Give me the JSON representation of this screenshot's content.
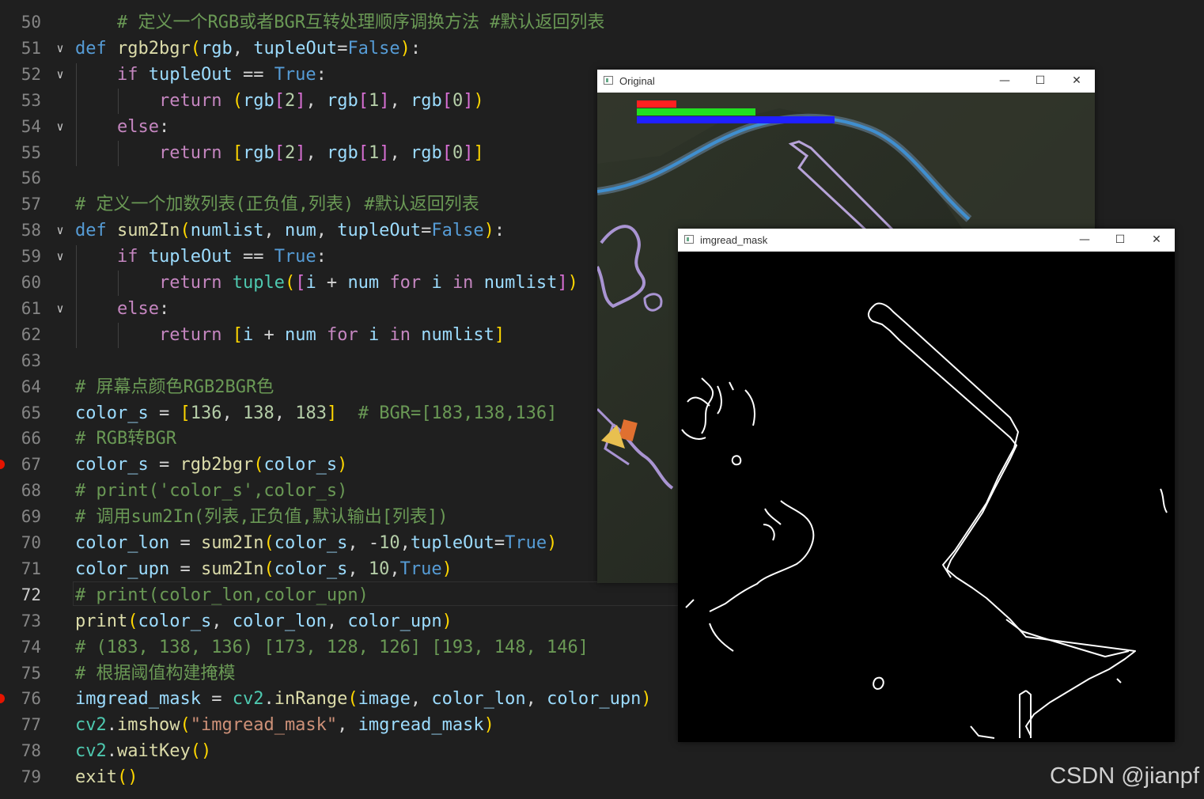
{
  "editor": {
    "active_line": "72",
    "lines": [
      {
        "n": "50",
        "fold": "",
        "bp": false,
        "tokens": [
          {
            "t": "    # 定义一个RGB或者BGR互转处理顺序调换方法 #默认返回列表",
            "c": "c-comment"
          }
        ]
      },
      {
        "n": "51",
        "fold": "∨",
        "bp": false,
        "tokens": [
          {
            "t": "def",
            "c": "c-kw"
          },
          {
            "t": " "
          },
          {
            "t": "rgb2bgr",
            "c": "c-fn"
          },
          {
            "t": "(",
            "c": "b1"
          },
          {
            "t": "rgb",
            "c": "c-var"
          },
          {
            "t": ", "
          },
          {
            "t": "tupleOut",
            "c": "c-var"
          },
          {
            "t": "="
          },
          {
            "t": "False",
            "c": "c-kw"
          },
          {
            "t": ")",
            "c": "b1"
          },
          {
            "t": ":"
          }
        ]
      },
      {
        "n": "52",
        "fold": "∨",
        "bp": false,
        "tokens": [
          {
            "t": "    "
          },
          {
            "t": "if",
            "c": "c-ctrl"
          },
          {
            "t": " "
          },
          {
            "t": "tupleOut",
            "c": "c-var"
          },
          {
            "t": " == "
          },
          {
            "t": "True",
            "c": "c-kw"
          },
          {
            "t": ":"
          }
        ]
      },
      {
        "n": "53",
        "fold": "",
        "bp": false,
        "tokens": [
          {
            "t": "        "
          },
          {
            "t": "return",
            "c": "c-ctrl"
          },
          {
            "t": " "
          },
          {
            "t": "(",
            "c": "b1"
          },
          {
            "t": "rgb",
            "c": "c-var"
          },
          {
            "t": "[",
            "c": "b2"
          },
          {
            "t": "2",
            "c": "c-num"
          },
          {
            "t": "]",
            "c": "b2"
          },
          {
            "t": ", "
          },
          {
            "t": "rgb",
            "c": "c-var"
          },
          {
            "t": "[",
            "c": "b2"
          },
          {
            "t": "1",
            "c": "c-num"
          },
          {
            "t": "]",
            "c": "b2"
          },
          {
            "t": ", "
          },
          {
            "t": "rgb",
            "c": "c-var"
          },
          {
            "t": "[",
            "c": "b2"
          },
          {
            "t": "0",
            "c": "c-num"
          },
          {
            "t": "]",
            "c": "b2"
          },
          {
            "t": ")",
            "c": "b1"
          }
        ]
      },
      {
        "n": "54",
        "fold": "∨",
        "bp": false,
        "tokens": [
          {
            "t": "    "
          },
          {
            "t": "else",
            "c": "c-ctrl"
          },
          {
            "t": ":"
          }
        ]
      },
      {
        "n": "55",
        "fold": "",
        "bp": false,
        "tokens": [
          {
            "t": "        "
          },
          {
            "t": "return",
            "c": "c-ctrl"
          },
          {
            "t": " "
          },
          {
            "t": "[",
            "c": "b1"
          },
          {
            "t": "rgb",
            "c": "c-var"
          },
          {
            "t": "[",
            "c": "b2"
          },
          {
            "t": "2",
            "c": "c-num"
          },
          {
            "t": "]",
            "c": "b2"
          },
          {
            "t": ", "
          },
          {
            "t": "rgb",
            "c": "c-var"
          },
          {
            "t": "[",
            "c": "b2"
          },
          {
            "t": "1",
            "c": "c-num"
          },
          {
            "t": "]",
            "c": "b2"
          },
          {
            "t": ", "
          },
          {
            "t": "rgb",
            "c": "c-var"
          },
          {
            "t": "[",
            "c": "b2"
          },
          {
            "t": "0",
            "c": "c-num"
          },
          {
            "t": "]",
            "c": "b2"
          },
          {
            "t": "]",
            "c": "b1"
          }
        ]
      },
      {
        "n": "56",
        "fold": "",
        "bp": false,
        "tokens": []
      },
      {
        "n": "57",
        "fold": "",
        "bp": false,
        "tokens": [
          {
            "t": "# 定义一个加数列表(正负值,列表) #默认返回列表",
            "c": "c-comment"
          }
        ]
      },
      {
        "n": "58",
        "fold": "∨",
        "bp": false,
        "tokens": [
          {
            "t": "def",
            "c": "c-kw"
          },
          {
            "t": " "
          },
          {
            "t": "sum2In",
            "c": "c-fn"
          },
          {
            "t": "(",
            "c": "b1"
          },
          {
            "t": "numlist",
            "c": "c-var"
          },
          {
            "t": ", "
          },
          {
            "t": "num",
            "c": "c-var"
          },
          {
            "t": ", "
          },
          {
            "t": "tupleOut",
            "c": "c-var"
          },
          {
            "t": "="
          },
          {
            "t": "False",
            "c": "c-kw"
          },
          {
            "t": ")",
            "c": "b1"
          },
          {
            "t": ":"
          }
        ]
      },
      {
        "n": "59",
        "fold": "∨",
        "bp": false,
        "tokens": [
          {
            "t": "    "
          },
          {
            "t": "if",
            "c": "c-ctrl"
          },
          {
            "t": " "
          },
          {
            "t": "tupleOut",
            "c": "c-var"
          },
          {
            "t": " == "
          },
          {
            "t": "True",
            "c": "c-kw"
          },
          {
            "t": ":"
          }
        ]
      },
      {
        "n": "60",
        "fold": "",
        "bp": false,
        "tokens": [
          {
            "t": "        "
          },
          {
            "t": "return",
            "c": "c-ctrl"
          },
          {
            "t": " "
          },
          {
            "t": "tuple",
            "c": "c-cls"
          },
          {
            "t": "(",
            "c": "b1"
          },
          {
            "t": "[",
            "c": "b2"
          },
          {
            "t": "i",
            "c": "c-var"
          },
          {
            "t": " + "
          },
          {
            "t": "num",
            "c": "c-var"
          },
          {
            "t": " "
          },
          {
            "t": "for",
            "c": "c-ctrl"
          },
          {
            "t": " "
          },
          {
            "t": "i",
            "c": "c-var"
          },
          {
            "t": " "
          },
          {
            "t": "in",
            "c": "c-ctrl"
          },
          {
            "t": " "
          },
          {
            "t": "numlist",
            "c": "c-var"
          },
          {
            "t": "]",
            "c": "b2"
          },
          {
            "t": ")",
            "c": "b1"
          }
        ]
      },
      {
        "n": "61",
        "fold": "∨",
        "bp": false,
        "tokens": [
          {
            "t": "    "
          },
          {
            "t": "else",
            "c": "c-ctrl"
          },
          {
            "t": ":"
          }
        ]
      },
      {
        "n": "62",
        "fold": "",
        "bp": false,
        "tokens": [
          {
            "t": "        "
          },
          {
            "t": "return",
            "c": "c-ctrl"
          },
          {
            "t": " "
          },
          {
            "t": "[",
            "c": "b1"
          },
          {
            "t": "i",
            "c": "c-var"
          },
          {
            "t": " + "
          },
          {
            "t": "num",
            "c": "c-var"
          },
          {
            "t": " "
          },
          {
            "t": "for",
            "c": "c-ctrl"
          },
          {
            "t": " "
          },
          {
            "t": "i",
            "c": "c-var"
          },
          {
            "t": " "
          },
          {
            "t": "in",
            "c": "c-ctrl"
          },
          {
            "t": " "
          },
          {
            "t": "numlist",
            "c": "c-var"
          },
          {
            "t": "]",
            "c": "b1"
          }
        ]
      },
      {
        "n": "63",
        "fold": "",
        "bp": false,
        "tokens": []
      },
      {
        "n": "64",
        "fold": "",
        "bp": false,
        "tokens": [
          {
            "t": "# 屏幕点颜色RGB2BGR色",
            "c": "c-comment"
          }
        ]
      },
      {
        "n": "65",
        "fold": "",
        "bp": false,
        "tokens": [
          {
            "t": "color_s",
            "c": "c-var"
          },
          {
            "t": " = "
          },
          {
            "t": "[",
            "c": "b1"
          },
          {
            "t": "136",
            "c": "c-num"
          },
          {
            "t": ", "
          },
          {
            "t": "138",
            "c": "c-num"
          },
          {
            "t": ", "
          },
          {
            "t": "183",
            "c": "c-num"
          },
          {
            "t": "]",
            "c": "b1"
          },
          {
            "t": "  "
          },
          {
            "t": "# BGR=[183,138,136]",
            "c": "c-comment"
          }
        ]
      },
      {
        "n": "66",
        "fold": "",
        "bp": false,
        "tokens": [
          {
            "t": "# RGB转BGR",
            "c": "c-comment"
          }
        ]
      },
      {
        "n": "67",
        "fold": "",
        "bp": true,
        "tokens": [
          {
            "t": "color_s",
            "c": "c-var"
          },
          {
            "t": " = "
          },
          {
            "t": "rgb2bgr",
            "c": "c-fn"
          },
          {
            "t": "(",
            "c": "b1"
          },
          {
            "t": "color_s",
            "c": "c-var"
          },
          {
            "t": ")",
            "c": "b1"
          }
        ]
      },
      {
        "n": "68",
        "fold": "",
        "bp": false,
        "tokens": [
          {
            "t": "# print('color_s',color_s)",
            "c": "c-comment"
          }
        ]
      },
      {
        "n": "69",
        "fold": "",
        "bp": false,
        "tokens": [
          {
            "t": "# 调用sum2In(列表,正负值,默认输出[列表])",
            "c": "c-comment"
          }
        ]
      },
      {
        "n": "70",
        "fold": "",
        "bp": false,
        "tokens": [
          {
            "t": "color_lon",
            "c": "c-var"
          },
          {
            "t": " = "
          },
          {
            "t": "sum2In",
            "c": "c-fn"
          },
          {
            "t": "(",
            "c": "b1"
          },
          {
            "t": "color_s",
            "c": "c-var"
          },
          {
            "t": ", -"
          },
          {
            "t": "10",
            "c": "c-num"
          },
          {
            "t": ","
          },
          {
            "t": "tupleOut",
            "c": "c-var"
          },
          {
            "t": "="
          },
          {
            "t": "True",
            "c": "c-kw"
          },
          {
            "t": ")",
            "c": "b1"
          }
        ]
      },
      {
        "n": "71",
        "fold": "",
        "bp": false,
        "tokens": [
          {
            "t": "color_upn",
            "c": "c-var"
          },
          {
            "t": " = "
          },
          {
            "t": "sum2In",
            "c": "c-fn"
          },
          {
            "t": "(",
            "c": "b1"
          },
          {
            "t": "color_s",
            "c": "c-var"
          },
          {
            "t": ", "
          },
          {
            "t": "10",
            "c": "c-num"
          },
          {
            "t": ","
          },
          {
            "t": "True",
            "c": "c-kw"
          },
          {
            "t": ")",
            "c": "b1"
          }
        ]
      },
      {
        "n": "72",
        "fold": "",
        "bp": false,
        "tokens": [
          {
            "t": "# print(color_lon,color_upn)",
            "c": "c-comment"
          }
        ]
      },
      {
        "n": "73",
        "fold": "",
        "bp": false,
        "tokens": [
          {
            "t": "print",
            "c": "c-fn"
          },
          {
            "t": "(",
            "c": "b1"
          },
          {
            "t": "color_s",
            "c": "c-var"
          },
          {
            "t": ", "
          },
          {
            "t": "color_lon",
            "c": "c-var"
          },
          {
            "t": ", "
          },
          {
            "t": "color_upn",
            "c": "c-var"
          },
          {
            "t": ")",
            "c": "b1"
          }
        ]
      },
      {
        "n": "74",
        "fold": "",
        "bp": false,
        "tokens": [
          {
            "t": "# (183, 138, 136) [173, 128, 126] [193, 148, 146]",
            "c": "c-comment"
          }
        ]
      },
      {
        "n": "75",
        "fold": "",
        "bp": false,
        "tokens": [
          {
            "t": "# 根据阈值构建掩模",
            "c": "c-comment"
          }
        ]
      },
      {
        "n": "76",
        "fold": "",
        "bp": true,
        "tokens": [
          {
            "t": "imgread_mask",
            "c": "c-var"
          },
          {
            "t": " = "
          },
          {
            "t": "cv2",
            "c": "c-cls"
          },
          {
            "t": "."
          },
          {
            "t": "inRange",
            "c": "c-fn"
          },
          {
            "t": "(",
            "c": "b1"
          },
          {
            "t": "image",
            "c": "c-var"
          },
          {
            "t": ", "
          },
          {
            "t": "color_lon",
            "c": "c-var"
          },
          {
            "t": ", "
          },
          {
            "t": "color_upn",
            "c": "c-var"
          },
          {
            "t": ")",
            "c": "b1"
          }
        ]
      },
      {
        "n": "77",
        "fold": "",
        "bp": false,
        "tokens": [
          {
            "t": "cv2",
            "c": "c-cls"
          },
          {
            "t": "."
          },
          {
            "t": "imshow",
            "c": "c-fn"
          },
          {
            "t": "(",
            "c": "b1"
          },
          {
            "t": "\"imgread_mask\"",
            "c": "c-str"
          },
          {
            "t": ", "
          },
          {
            "t": "imgread_mask",
            "c": "c-var"
          },
          {
            "t": ")",
            "c": "b1"
          }
        ]
      },
      {
        "n": "78",
        "fold": "",
        "bp": false,
        "tokens": [
          {
            "t": "cv2",
            "c": "c-cls"
          },
          {
            "t": "."
          },
          {
            "t": "waitKey",
            "c": "c-fn"
          },
          {
            "t": "(",
            "c": "b1"
          },
          {
            "t": ")",
            "c": "b1"
          }
        ]
      },
      {
        "n": "79",
        "fold": "",
        "bp": false,
        "tokens": [
          {
            "t": "exit",
            "c": "c-fn"
          },
          {
            "t": "(",
            "c": "b1"
          },
          {
            "t": ")",
            "c": "b1"
          }
        ]
      }
    ]
  },
  "window_original": {
    "title": "Original",
    "minimize": "—",
    "maximize": "☐",
    "close": "✕",
    "bars": [
      {
        "color": "#ff2020",
        "fraction": 0.2
      },
      {
        "color": "#20e020",
        "fraction": 0.6
      },
      {
        "color": "#2020ff",
        "fraction": 1.0
      }
    ]
  },
  "window_mask": {
    "title": "imgread_mask",
    "minimize": "—",
    "maximize": "☐",
    "close": "✕"
  },
  "watermark": "CSDN @jianpf"
}
